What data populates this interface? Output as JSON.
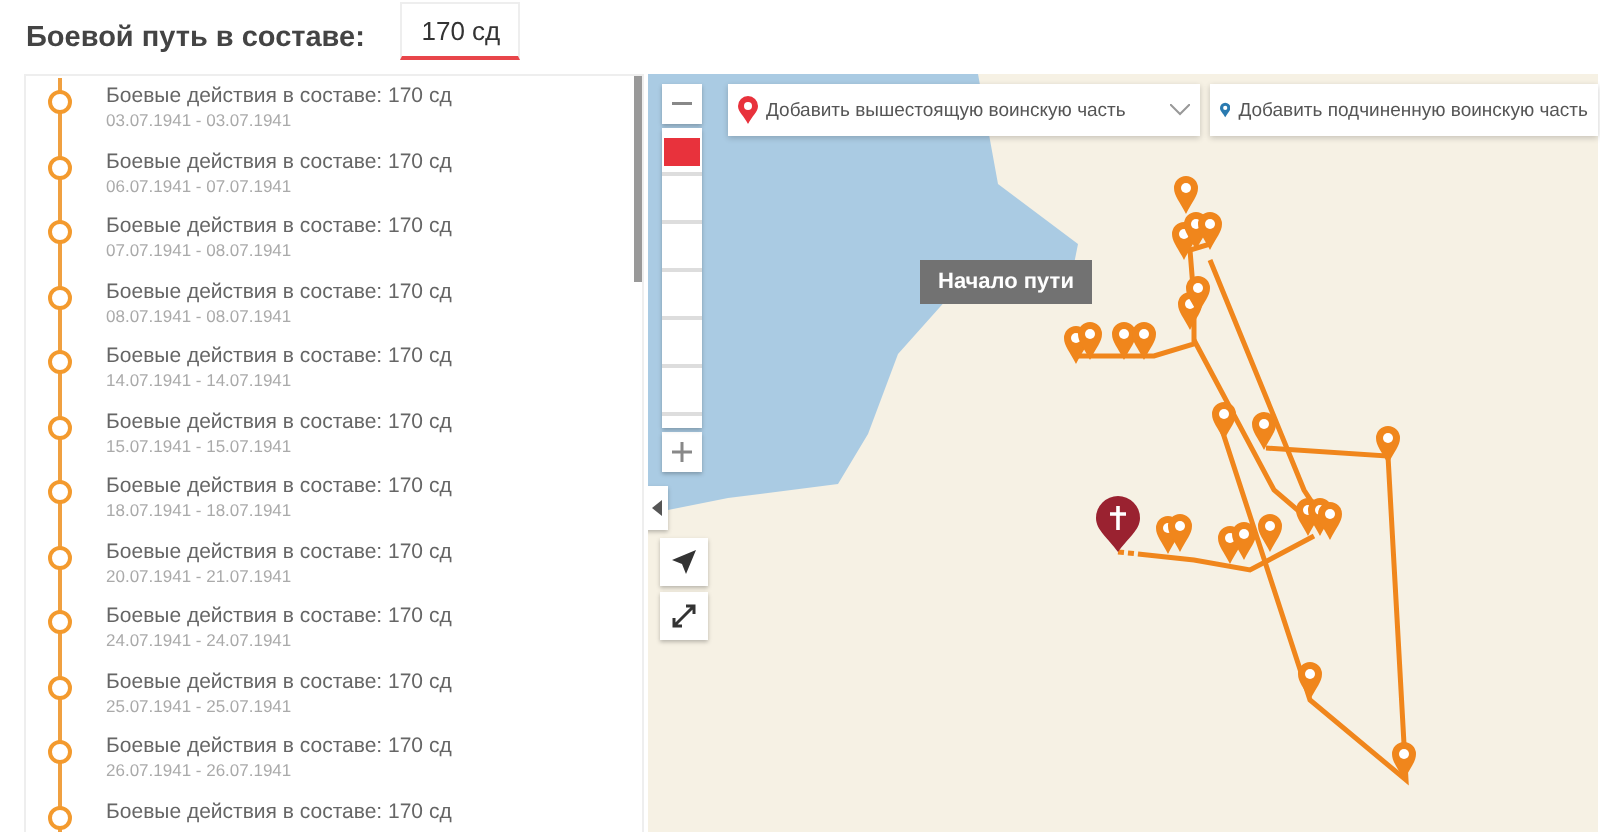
{
  "header": {
    "title": "Боевой путь в составе:",
    "unit_field": {
      "value": "170 сд"
    }
  },
  "timeline": {
    "items": [
      {
        "title": "Боевые действия в составе: 170 сд",
        "dates": "03.07.1941 - 03.07.1941"
      },
      {
        "title": "Боевые действия в составе: 170 сд",
        "dates": "06.07.1941 - 07.07.1941"
      },
      {
        "title": "Боевые действия в составе: 170 сд",
        "dates": "07.07.1941 - 08.07.1941"
      },
      {
        "title": "Боевые действия в составе: 170 сд",
        "dates": "08.07.1941 - 08.07.1941"
      },
      {
        "title": "Боевые действия в составе: 170 сд",
        "dates": "14.07.1941 - 14.07.1941"
      },
      {
        "title": "Боевые действия в составе: 170 сд",
        "dates": "15.07.1941 - 15.07.1941"
      },
      {
        "title": "Боевые действия в составе: 170 сд",
        "dates": "18.07.1941 - 18.07.1941"
      },
      {
        "title": "Боевые действия в составе: 170 сд",
        "dates": "20.07.1941 - 21.07.1941"
      },
      {
        "title": "Боевые действия в составе: 170 сд",
        "dates": "24.07.1941 - 24.07.1941"
      },
      {
        "title": "Боевые действия в составе: 170 сд",
        "dates": "25.07.1941 - 25.07.1941"
      },
      {
        "title": "Боевые действия в составе: 170 сд",
        "dates": "26.07.1941 - 26.07.1941"
      },
      {
        "title": "Боевые действия в составе: 170 сд"
      }
    ]
  },
  "map": {
    "selectors": [
      {
        "placeholder": "Добавить вышестоящую воинскую часть",
        "kind": "dropdown",
        "color": "#e8323c"
      },
      {
        "placeholder": "Добавить подчиненную воинскую часть",
        "kind": "input",
        "color": "#2a7ab0"
      }
    ],
    "tooltip": "Начало пути",
    "zoom": {
      "level": 0.04
    }
  }
}
